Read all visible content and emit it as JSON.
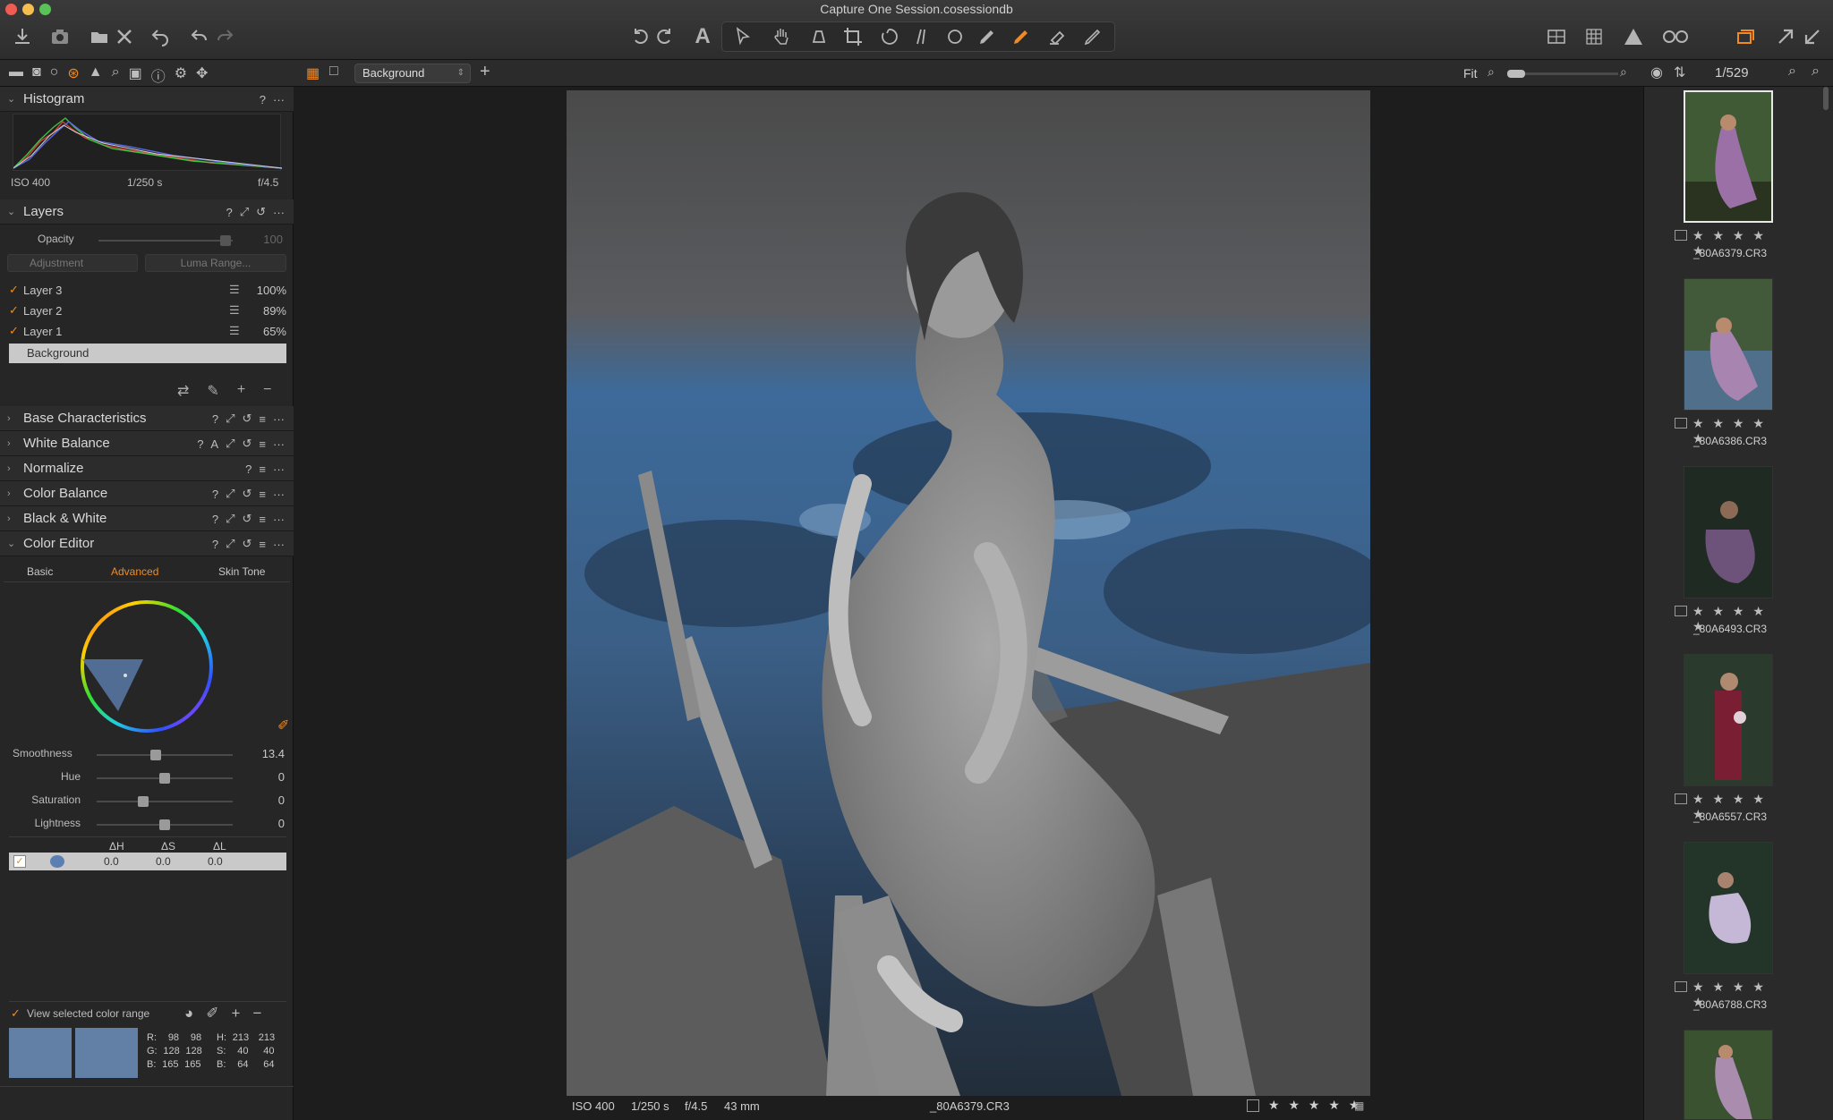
{
  "window": {
    "title": "Capture One Session.cosessiondb"
  },
  "colors": {
    "accent": "#f08a24",
    "panel": "#262626",
    "bg": "#1d1d1d",
    "swatch": "#6280a5"
  },
  "toolbar_icons": [
    "import-icon",
    "camera-icon",
    "folder-icon",
    "delete-icon",
    "undo-icon",
    "redo-icon",
    "rotate-left-icon",
    "rotate-right-icon",
    "text-icon",
    "select-icon",
    "pan-icon",
    "crop-icon",
    "straighten-icon",
    "keystone-icon",
    "circle-icon",
    "brush-icon",
    "color-picker-icon",
    "eraser-icon",
    "pen-icon",
    "viewer-grid-icon",
    "grid-icon",
    "warning-icon",
    "glasses-icon",
    "stack-icon",
    "export-icon"
  ],
  "subbar": {
    "layer_selector": "Background",
    "fit_label": "Fit",
    "counter": "1/529"
  },
  "histogram": {
    "title": "Histogram",
    "iso": "ISO 400",
    "shutter": "1/250 s",
    "aperture": "f/4.5"
  },
  "layers": {
    "title": "Layers",
    "opacity_label": "Opacity",
    "opacity_value": "100",
    "adjustment_label": "Adjustment",
    "luma_label": "Luma Range...",
    "items": [
      {
        "name": "Layer 3",
        "value": "100%"
      },
      {
        "name": "Layer 2",
        "value": "89%"
      },
      {
        "name": "Layer 1",
        "value": "65%"
      }
    ],
    "background": "Background"
  },
  "sections": [
    {
      "label": "Base Characteristics"
    },
    {
      "label": "White Balance"
    },
    {
      "label": "Normalize"
    },
    {
      "label": "Color Balance"
    },
    {
      "label": "Black & White"
    },
    {
      "label": "Color Editor"
    }
  ],
  "color_editor": {
    "tabs": [
      "Basic",
      "Advanced",
      "Skin Tone"
    ],
    "active_tab": "Advanced",
    "sliders": [
      {
        "label": "Smoothness",
        "value": "13.4",
        "pos": 0.44
      },
      {
        "label": "Hue",
        "value": "0",
        "pos": 0.5
      },
      {
        "label": "Saturation",
        "value": "0",
        "pos": 0.35
      },
      {
        "label": "Lightness",
        "value": "0",
        "pos": 0.5
      }
    ],
    "table_headers": [
      "ΔH",
      "ΔS",
      "ΔL"
    ],
    "row": {
      "dh": "0.0",
      "ds": "0.0",
      "dl": "0.0"
    },
    "view_selected": "View selected color range",
    "rgb": {
      "r": "R:",
      "r1": "98",
      "r2": "98",
      "g": "G:",
      "g1": "128",
      "g2": "128",
      "b": "B:",
      "b1": "165",
      "b2": "165"
    },
    "hsb": {
      "h": "H:",
      "h1": "213",
      "h2": "213",
      "s": "S:",
      "s1": "40",
      "s2": "40",
      "b": "B:",
      "b1": "64",
      "b2": "64"
    }
  },
  "viewer": {
    "iso": "ISO 400",
    "shutter": "1/250 s",
    "aperture": "f/4.5",
    "focal": "43 mm",
    "filename": "_80A6379.CR3"
  },
  "browser": {
    "thumbs": [
      {
        "name": "_80A6379.CR3",
        "selected": true
      },
      {
        "name": "_80A6386.CR3",
        "selected": false
      },
      {
        "name": "_80A6493.CR3",
        "selected": false
      },
      {
        "name": "_80A6557.CR3",
        "selected": false
      },
      {
        "name": "_80A6788.CR3",
        "selected": false
      }
    ]
  },
  "stars": "★ ★ ★ ★ ★"
}
